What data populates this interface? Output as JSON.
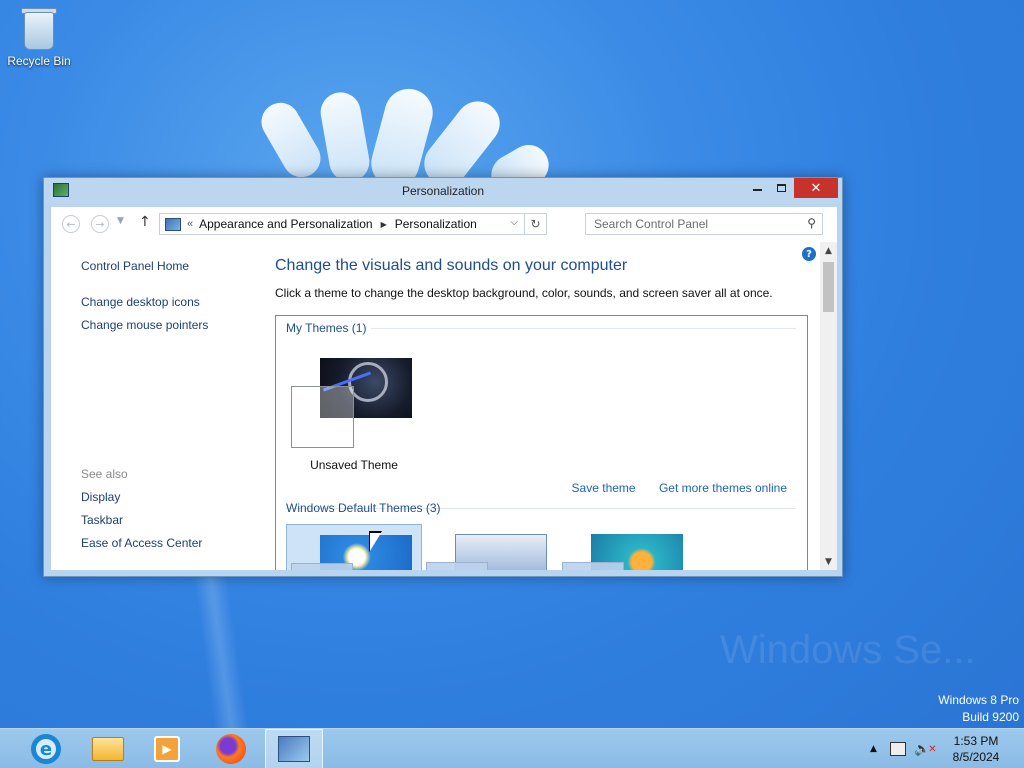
{
  "desktop": {
    "icons": [
      {
        "label": "Recycle Bin",
        "icon": "recycle-bin-icon"
      }
    ],
    "edition": {
      "line1": "Windows 8 Pro",
      "line2": "Build 9200"
    }
  },
  "window": {
    "title": "Personalization",
    "breadcrumb": [
      "Appearance and Personalization",
      "Personalization"
    ],
    "search": {
      "placeholder": "Search Control Panel"
    },
    "left_nav": {
      "home": "Control Panel Home",
      "links": [
        "Change desktop icons",
        "Change mouse pointers"
      ],
      "see_also_label": "See also",
      "see_also": [
        "Display",
        "Taskbar",
        "Ease of Access Center"
      ]
    },
    "main": {
      "heading": "Change the visuals and sounds on your computer",
      "description": "Click a theme to change the desktop background, color, sounds, and screen saver all at once.",
      "my_themes": {
        "title": "My Themes (1)",
        "items": [
          {
            "name": "Unsaved Theme"
          }
        ]
      },
      "links": {
        "save": "Save theme",
        "more": "Get more themes online"
      },
      "default_themes": {
        "title": "Windows Default Themes (3)"
      }
    }
  },
  "taskbar": {
    "apps": [
      "internet-explorer-icon",
      "file-explorer-icon",
      "media-center-icon",
      "firefox-icon",
      "control-panel-icon"
    ],
    "clock": {
      "time": "1:53 PM",
      "date": "8/5/2024"
    }
  },
  "colors": {
    "accent": "#1f4e8a",
    "link": "#1e63b6",
    "close": "#c7332b",
    "taskbar": "#8bbbe6"
  }
}
